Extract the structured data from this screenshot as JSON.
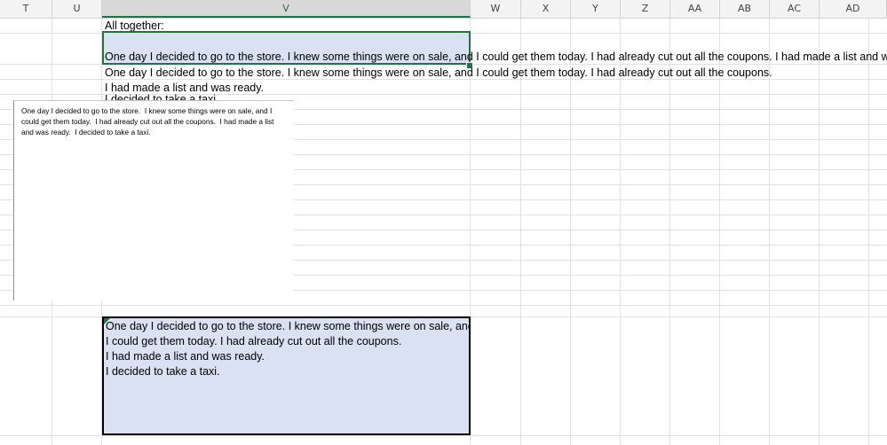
{
  "columns": [
    "T",
    "U",
    "V",
    "W",
    "X",
    "Y",
    "Z",
    "AA",
    "AB",
    "AC",
    "AD"
  ],
  "selected_column": "V",
  "cells": {
    "v2": "All together:",
    "v4": "One day I decided to go to the store.  I knew some things were on sale, and I could get them today.  I had already cut out all the coupons.  I had made a list and was r",
    "v5": "One day I decided to go to the store.  I knew some things were on sale, and I could get them today.  I had already cut out all the coupons.",
    "v6": "I had made a list and was ready.",
    "v7_partial": "I decided to take a taxi."
  },
  "textbox": {
    "text": "One day I decided to go to the store.  I knew some things were on sale, and I could get them today.  I had already cut out all the coupons.  I had made a list and was ready.  I decided to take a taxi."
  },
  "wrapped_cell": {
    "lines": [
      "One day I decided to go to the store.  I knew some things were on sale, and",
      "I could get them today.  I had already cut out all the coupons.",
      "I had made a list and was ready.",
      "I decided to take a taxi."
    ]
  },
  "colors": {
    "selection_border": "#217346",
    "cell_fill": "#d9e1f2"
  }
}
